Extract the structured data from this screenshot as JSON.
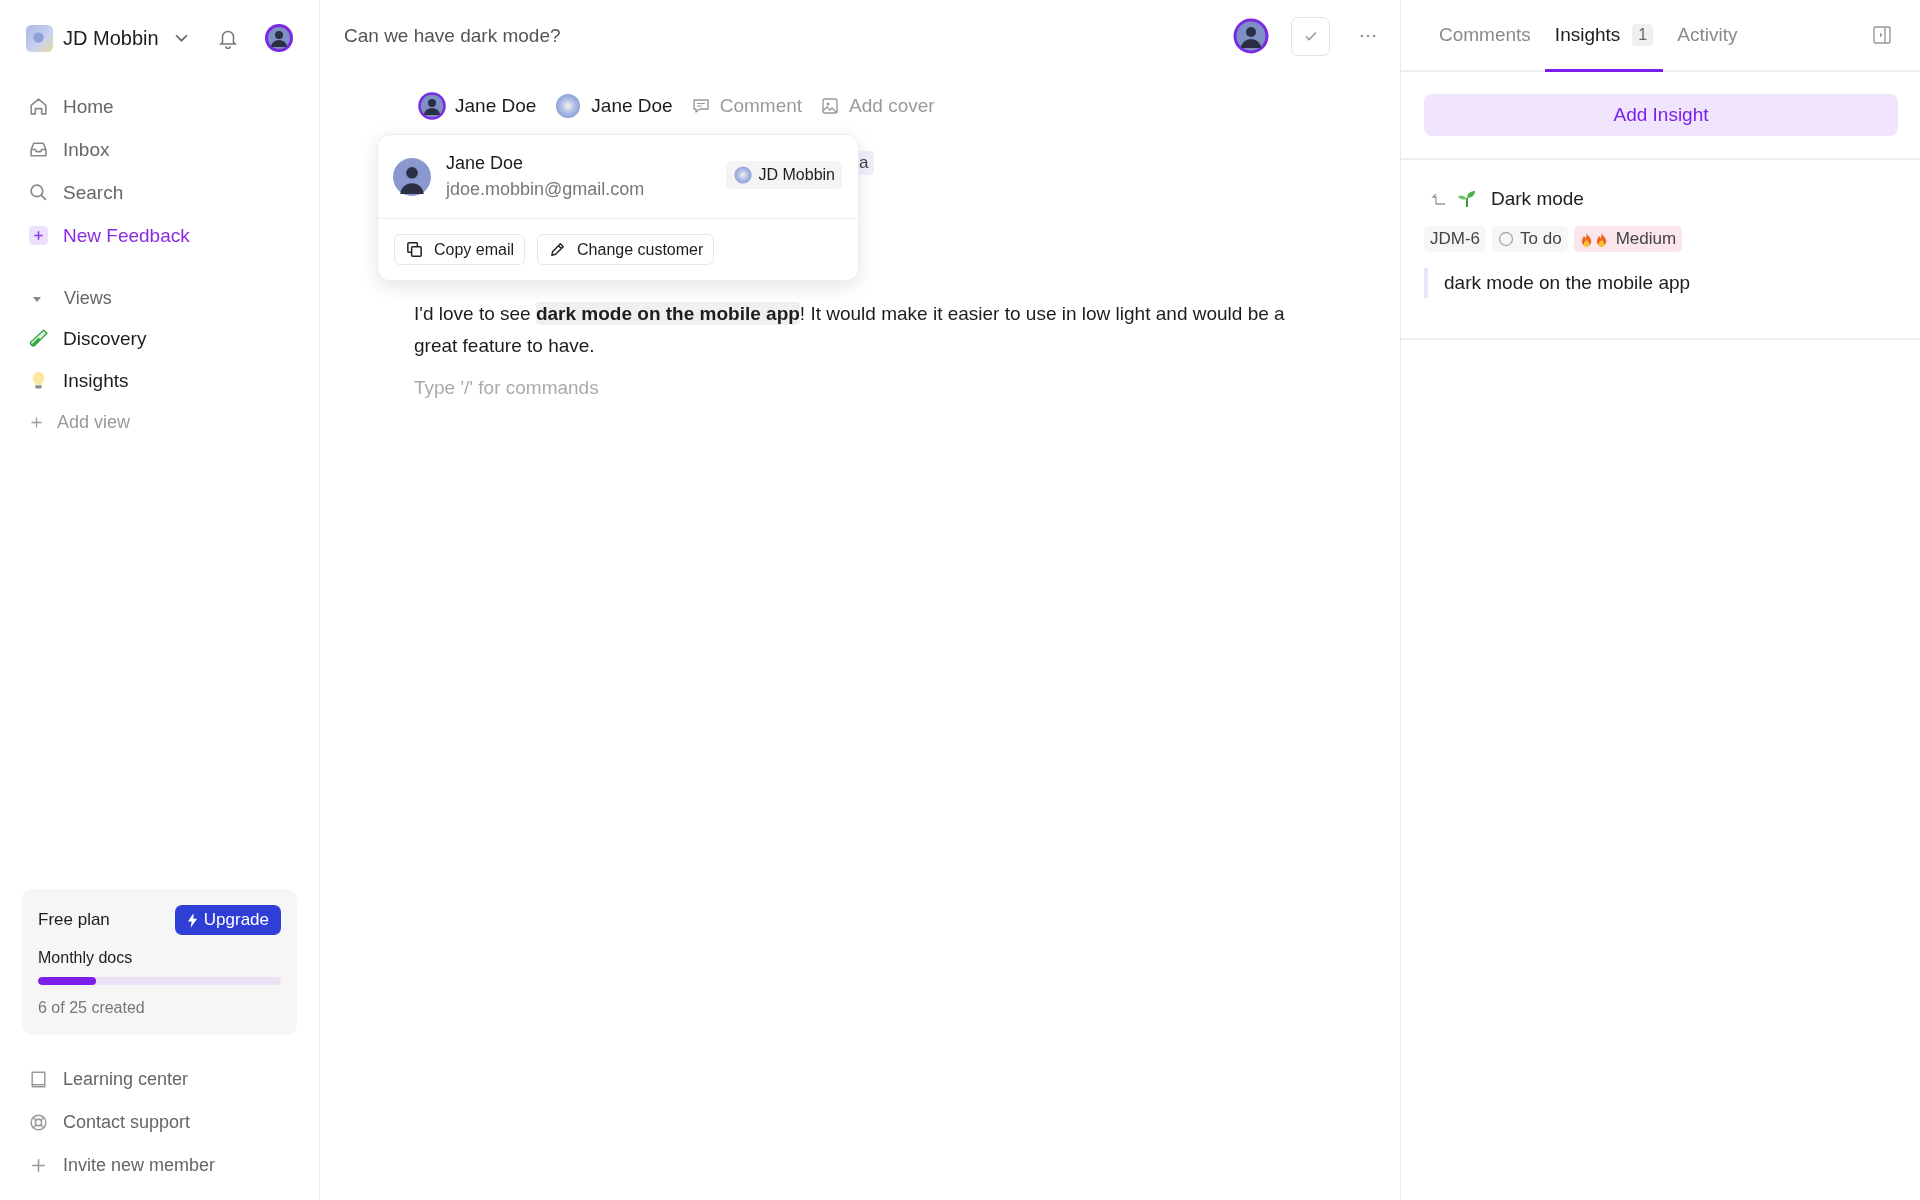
{
  "workspace": {
    "name": "JD Mobbin"
  },
  "nav": [
    {
      "label": "Home",
      "kind": "link"
    },
    {
      "label": "Inbox",
      "kind": "link"
    },
    {
      "label": "Search",
      "kind": "link"
    },
    {
      "label": "New Feedback",
      "kind": "action"
    }
  ],
  "views": {
    "label": "Views",
    "expanded": true,
    "items": [
      {
        "label": "Discovery"
      },
      {
        "label": "Insights"
      }
    ],
    "add_label": "Add view"
  },
  "plan": {
    "name": "Free plan",
    "upgrade": "Upgrade",
    "metric": "Monthly docs",
    "level": 0.24,
    "reading": "6 of 25 created"
  },
  "footer_links": [
    {
      "label": "Learning center"
    },
    {
      "label": "Contact support"
    },
    {
      "label": "Invite new member"
    }
  ],
  "document": {
    "title": "Can we have dark mode?",
    "people": [
      {
        "name": "Jane Doe"
      },
      {
        "name": "Jane Doe"
      }
    ],
    "actions": [
      {
        "label": "Comment"
      },
      {
        "label": "Add cover"
      }
    ],
    "covered_chip": "a",
    "body": "I'd love to see **dark mode on the mobile app**! It would make it easier to use in low light and would be a great feature to have.",
    "placeholder": "Type '/' for commands"
  },
  "customer_popup": {
    "name": "Jane Doe",
    "email": "jdoe.mobbin@gmail.com",
    "company": "JD Mobbin",
    "actions": [
      {
        "label": "Copy email"
      },
      {
        "label": "Change customer"
      }
    ]
  },
  "panel": {
    "tabs": [
      {
        "label": "Comments",
        "selected": false
      },
      {
        "label": "Insights",
        "selected": true,
        "count": "1"
      },
      {
        "label": "Activity",
        "selected": false
      }
    ],
    "add_button": "Add Insight",
    "insights": [
      {
        "title": "Dark mode",
        "id": "JDM-6",
        "status": "To do",
        "priority": "Medium",
        "quote": "dark mode on the mobile app"
      }
    ]
  }
}
